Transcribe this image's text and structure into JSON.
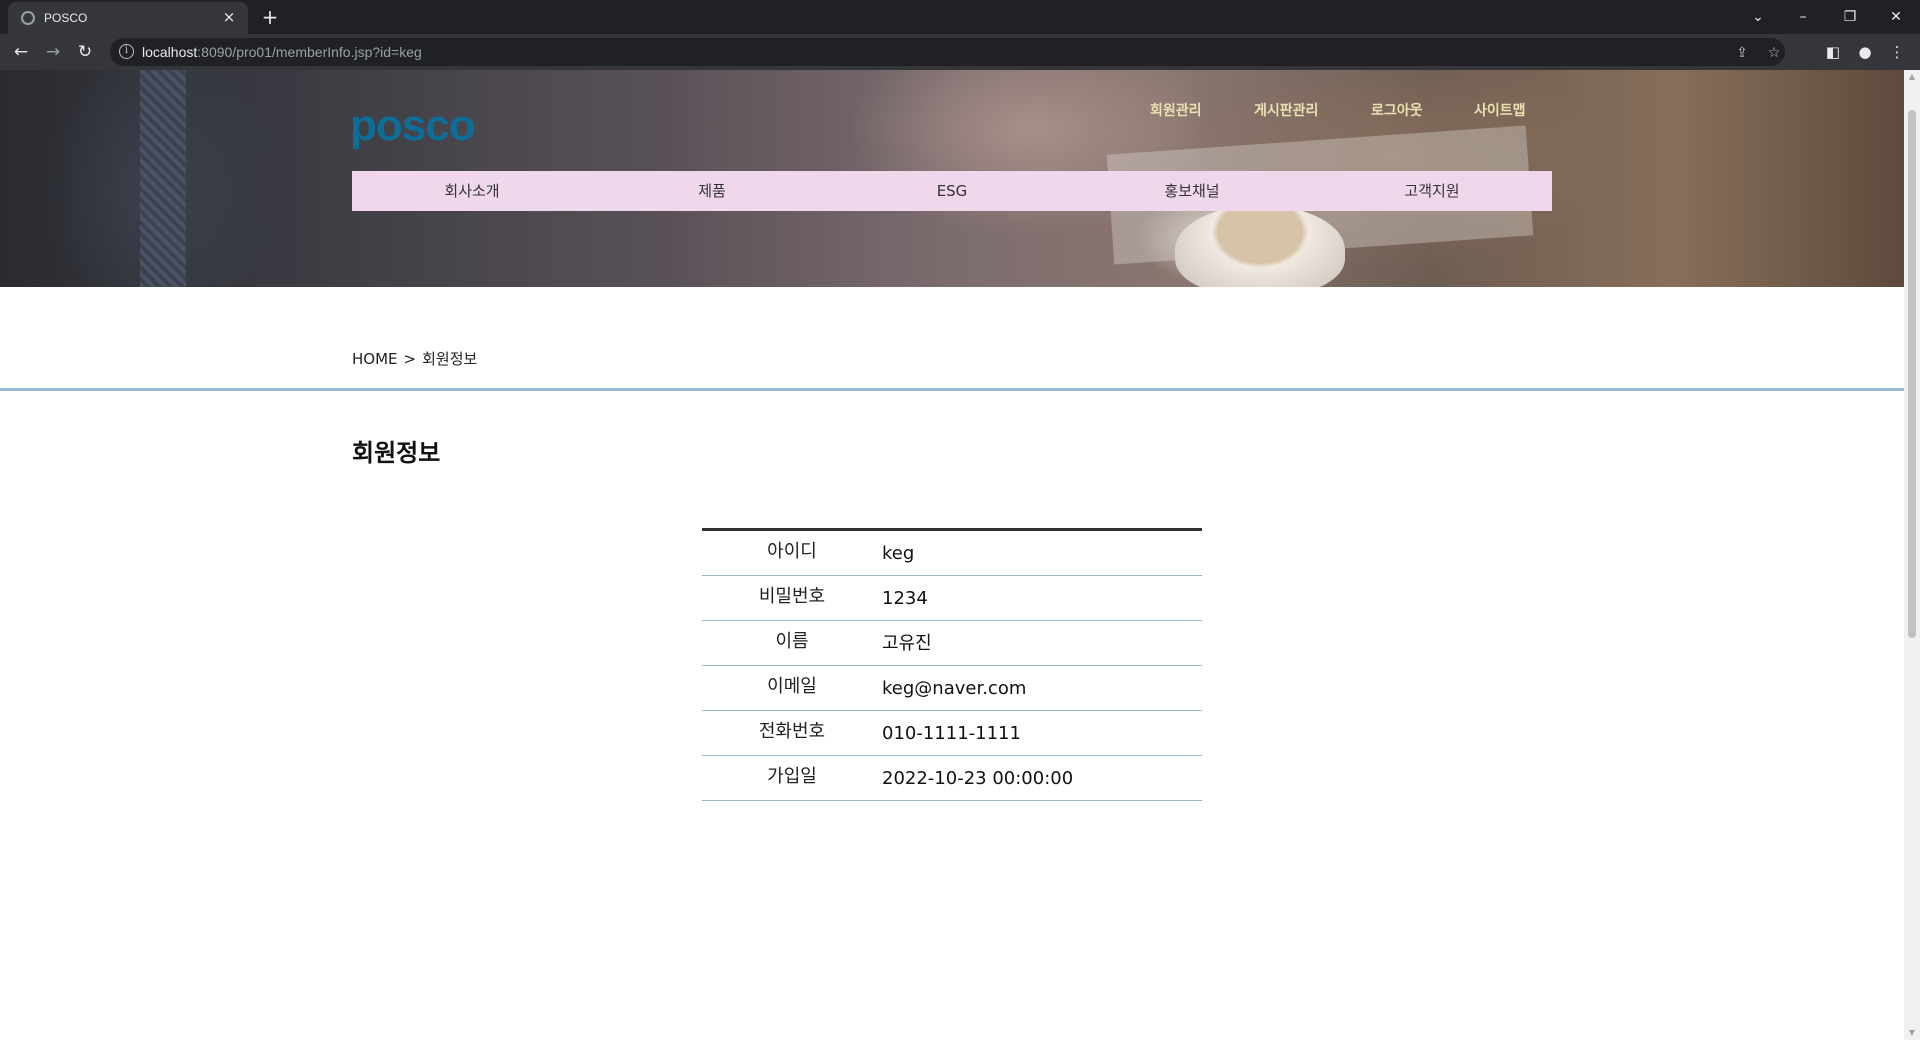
{
  "browser": {
    "tab_title": "POSCO",
    "tab_close": "×",
    "new_tab": "+",
    "url_host": "localhost",
    "url_rest": ":8090/pro01/memberInfo.jsp?id=keg",
    "icons": [
      "back-icon",
      "forward-icon",
      "reload-icon",
      "site-info-icon",
      "share-icon",
      "bookmark-star-icon",
      "side-panel-icon",
      "profile-icon",
      "menu-icon"
    ]
  },
  "site": {
    "logo_text": "posco",
    "logo_color": "#0d6d98",
    "top_links": [
      "회원관리",
      "게시판관리",
      "로그아웃",
      "사이트맵"
    ],
    "main_nav": [
      "회사소개",
      "제품",
      "ESG",
      "홍보채널",
      "고객지원"
    ],
    "nav_bg_color": "#f0d8ec"
  },
  "breadcrumb": {
    "home": "HOME",
    "separator": ">",
    "current": "회원정보"
  },
  "page_title": "회원정보",
  "member": [
    {
      "label": "아이디",
      "value": "keg"
    },
    {
      "label": "비밀번호",
      "value": "1234"
    },
    {
      "label": "이름",
      "value": "고유진"
    },
    {
      "label": "이메일",
      "value": "keg@naver.com"
    },
    {
      "label": "전화번호",
      "value": "010-1111-1111"
    },
    {
      "label": "가입일",
      "value": "2022-10-23 00:00:00"
    }
  ]
}
